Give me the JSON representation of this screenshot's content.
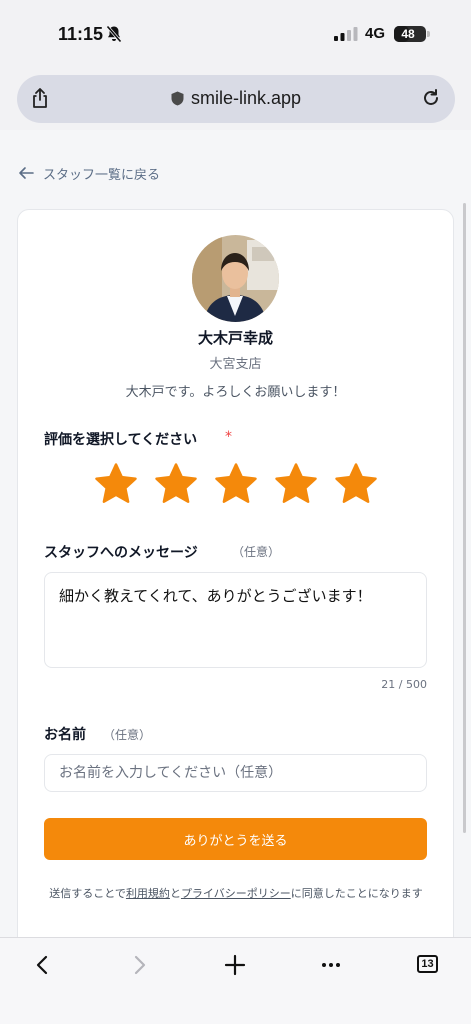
{
  "status_bar": {
    "time": "11:15",
    "network": "4G",
    "battery": "48",
    "battery_level": 0.48
  },
  "browser": {
    "url": "smile-link.app",
    "tab_count": "13"
  },
  "nav": {
    "back_label": "スタッフ一覧に戻る"
  },
  "staff": {
    "name": "大木戸幸成",
    "store": "大宮支店",
    "intro": "大木戸です。よろしくお願いします！"
  },
  "form": {
    "rating_label": "評価を選択してください",
    "required_mark": "*",
    "rating": {
      "value": 5,
      "max": 5
    },
    "message_label": "スタッフへのメッセージ",
    "message_optional": "（任意）",
    "message_value": "細かく教えてくれて、ありがとうございます！",
    "char_count": "21 / 500",
    "name_label": "お名前",
    "name_optional": "（任意）",
    "name_placeholder": "お名前を入力してください（任意）",
    "submit_label": "ありがとうを送る",
    "terms_prefix": "送信することで",
    "terms_link": "利用規約",
    "terms_and": "と",
    "privacy_link": "プライバシーポリシー",
    "terms_suffix": "に同意したことになります"
  },
  "colors": {
    "accent": "#f4890b",
    "star": "#f4890b",
    "required": "#ef4444"
  },
  "icons": [
    "bell-muted-icon",
    "share-icon",
    "lock-icon",
    "reload-icon",
    "arrow-left-icon",
    "star-icon",
    "chevron-left-icon",
    "chevron-right-icon",
    "plus-icon",
    "more-icon",
    "tabs-icon"
  ]
}
